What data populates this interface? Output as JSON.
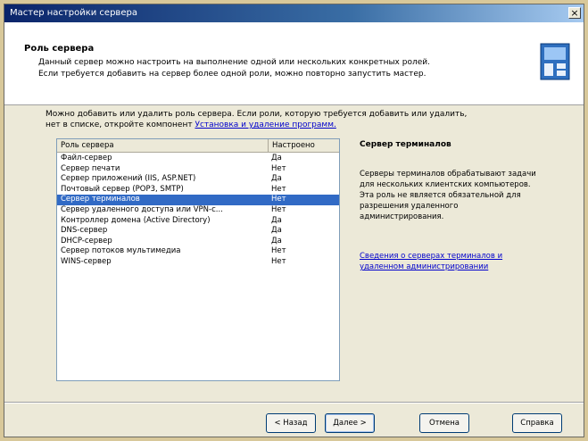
{
  "window": {
    "title": "Мастер настройки сервера",
    "close_glyph": "×"
  },
  "header": {
    "title": "Роль сервера",
    "description_line1": "Данный сервер можно настроить на выполнение одной или нескольких конкретных ролей.",
    "description_line2": "Если требуется добавить на сервер более одной роли, можно повторно запустить мастер.",
    "icon": "server-config-icon"
  },
  "intro": {
    "line1": "Можно добавить или удалить роль сервера. Если роли, которую требуется добавить или удалить,",
    "line2_prefix": "нет в списке, откройте компонент ",
    "line2_link": "Установка и удаление программ."
  },
  "list": {
    "columns": [
      "Роль сервера",
      "Настроено"
    ],
    "selected_index": 4,
    "rows": [
      {
        "role": "Файл-сервер",
        "configured": "Да"
      },
      {
        "role": "Сервер печати",
        "configured": "Нет"
      },
      {
        "role": "Сервер приложений (IIS, ASP.NET)",
        "configured": "Да"
      },
      {
        "role": "Почтовый сервер (POP3, SMTP)",
        "configured": "Нет"
      },
      {
        "role": "Сервер терминалов",
        "configured": "Нет"
      },
      {
        "role": "Сервер удаленного доступа или VPN-с...",
        "configured": "Нет"
      },
      {
        "role": "Контроллер домена (Active Directory)",
        "configured": "Да"
      },
      {
        "role": "DNS-сервер",
        "configured": "Да"
      },
      {
        "role": "DHCP-сервер",
        "configured": "Да"
      },
      {
        "role": "Сервер потоков мультимедиа",
        "configured": "Нет"
      },
      {
        "role": "WINS-сервер",
        "configured": "Нет"
      }
    ]
  },
  "details": {
    "title": "Сервер терминалов",
    "description": "Серверы терминалов обрабатывают задачи для нескольких клиентских компьютеров. Эта роль не является обязательной для разрешения удаленного администрирования.",
    "link": "Сведения о серверах терминалов и удаленном администрировании"
  },
  "buttons": {
    "back": "< Назад",
    "next": "Далее >",
    "cancel": "Отмена",
    "help": "Справка"
  }
}
